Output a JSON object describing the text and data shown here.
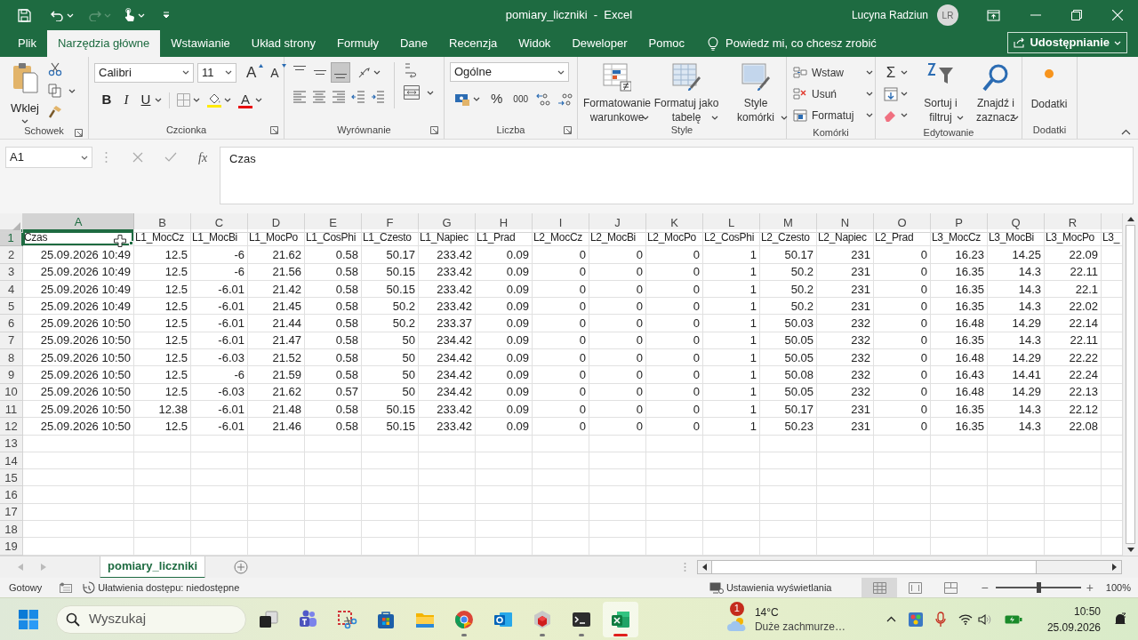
{
  "title_bar": {
    "document_title": "pomiary_liczniki  -  Excel",
    "user_name": "Lucyna Radziun",
    "avatar_initials": "LR"
  },
  "tabs": [
    {
      "label": "Plik",
      "selected": false
    },
    {
      "label": "Narzędzia główne",
      "selected": true
    },
    {
      "label": "Wstawianie",
      "selected": false
    },
    {
      "label": "Układ strony",
      "selected": false
    },
    {
      "label": "Formuły",
      "selected": false
    },
    {
      "label": "Dane",
      "selected": false
    },
    {
      "label": "Recenzja",
      "selected": false
    },
    {
      "label": "Widok",
      "selected": false
    },
    {
      "label": "Deweloper",
      "selected": false
    },
    {
      "label": "Pomoc",
      "selected": false
    }
  ],
  "tell_me": "Powiedz mi, co chcesz zrobić",
  "share_button": "Udostępnianie",
  "ribbon": {
    "clipboard": {
      "label": "Schowek",
      "paste": "Wklej"
    },
    "font": {
      "label": "Czcionka",
      "font_name": "Calibri",
      "font_size": "11",
      "grow": "A",
      "shrink": "A",
      "bold": "B",
      "italic": "I",
      "underline": "U",
      "font_color": "A"
    },
    "alignment": {
      "label": "Wyrównanie",
      "vertical_align": [
        {
          "kind": "top",
          "selected": false
        },
        {
          "kind": "middle",
          "selected": false
        },
        {
          "kind": "bottom",
          "selected": true
        }
      ]
    },
    "number": {
      "label": "Liczba",
      "format": "Ogólne",
      "percent": "%",
      "thousands": "000"
    },
    "styles": {
      "label": "Style",
      "buttons": [
        {
          "kind": "conditional",
          "label": "Formatowanie\nwarunkowe"
        },
        {
          "kind": "table",
          "label": "Formatuj jako\ntabelę"
        },
        {
          "kind": "cell_styles",
          "label": "Style\nkomórki"
        }
      ]
    },
    "cells": {
      "label": "Komórki",
      "buttons": [
        {
          "kind": "insert",
          "label": "Wstaw"
        },
        {
          "kind": "delete",
          "label": "Usuń"
        },
        {
          "kind": "format",
          "label": "Formatuj"
        }
      ]
    },
    "editing": {
      "label": "Edytowanie",
      "sum": "Σ",
      "buttons": [
        {
          "kind": "sort",
          "label": "Sortuj i\nfiltruj"
        },
        {
          "kind": "find",
          "label": "Znajdź i\nzaznacz"
        }
      ]
    },
    "addins": {
      "label": "Dodatki",
      "button": "Dodatki"
    }
  },
  "formula_bar": {
    "name_box": "A1",
    "function_label": "fx",
    "content": "Czas"
  },
  "sheet": {
    "columns": [
      {
        "label": "A",
        "selected": true
      },
      {
        "label": "B",
        "selected": false
      },
      {
        "label": "C",
        "selected": false
      },
      {
        "label": "D",
        "selected": false
      },
      {
        "label": "E",
        "selected": false
      },
      {
        "label": "F",
        "selected": false
      },
      {
        "label": "G",
        "selected": false
      },
      {
        "label": "H",
        "selected": false
      },
      {
        "label": "I",
        "selected": false
      },
      {
        "label": "J",
        "selected": false
      },
      {
        "label": "K",
        "selected": false
      },
      {
        "label": "L",
        "selected": false
      },
      {
        "label": "M",
        "selected": false
      },
      {
        "label": "N",
        "selected": false
      },
      {
        "label": "O",
        "selected": false
      },
      {
        "label": "P",
        "selected": false
      },
      {
        "label": "Q",
        "selected": false
      },
      {
        "label": "R",
        "selected": false
      }
    ],
    "rows": [
      {
        "number": "1",
        "selected": true,
        "kind": "text",
        "cells": [
          "Czas",
          "L1_MocCz",
          "L1_MocBi",
          "L1_MocPo",
          "L1_CosPhi",
          "L1_Czesto",
          "L1_Napiec",
          "L1_Prad",
          "L2_MocCz",
          "L2_MocBi",
          "L2_MocPo",
          "L2_CosPhi",
          "L2_Czesto",
          "L2_Napiec",
          "L2_Prad",
          "L3_MocCz",
          "L3_MocBi",
          "L3_MocPo",
          "L3_"
        ]
      },
      {
        "number": "2",
        "selected": false,
        "kind": "number",
        "cells": [
          "25.09.2026 10:49",
          "12.5",
          "-6",
          "21.62",
          "0.58",
          "50.17",
          "233.42",
          "0.09",
          "0",
          "0",
          "0",
          "1",
          "50.17",
          "231",
          "0",
          "16.23",
          "14.25",
          "22.09"
        ]
      },
      {
        "number": "3",
        "selected": false,
        "kind": "number",
        "cells": [
          "25.09.2026 10:49",
          "12.5",
          "-6",
          "21.56",
          "0.58",
          "50.15",
          "233.42",
          "0.09",
          "0",
          "0",
          "0",
          "1",
          "50.2",
          "231",
          "0",
          "16.35",
          "14.3",
          "22.11"
        ]
      },
      {
        "number": "4",
        "selected": false,
        "kind": "number",
        "cells": [
          "25.09.2026 10:49",
          "12.5",
          "-6.01",
          "21.42",
          "0.58",
          "50.15",
          "233.42",
          "0.09",
          "0",
          "0",
          "0",
          "1",
          "50.2",
          "231",
          "0",
          "16.35",
          "14.3",
          "22.1"
        ]
      },
      {
        "number": "5",
        "selected": false,
        "kind": "number",
        "cells": [
          "25.09.2026 10:49",
          "12.5",
          "-6.01",
          "21.45",
          "0.58",
          "50.2",
          "233.42",
          "0.09",
          "0",
          "0",
          "0",
          "1",
          "50.2",
          "231",
          "0",
          "16.35",
          "14.3",
          "22.02"
        ]
      },
      {
        "number": "6",
        "selected": false,
        "kind": "number",
        "cells": [
          "25.09.2026 10:50",
          "12.5",
          "-6.01",
          "21.44",
          "0.58",
          "50.2",
          "233.37",
          "0.09",
          "0",
          "0",
          "0",
          "1",
          "50.03",
          "232",
          "0",
          "16.48",
          "14.29",
          "22.14"
        ]
      },
      {
        "number": "7",
        "selected": false,
        "kind": "number",
        "cells": [
          "25.09.2026 10:50",
          "12.5",
          "-6.01",
          "21.47",
          "0.58",
          "50",
          "234.42",
          "0.09",
          "0",
          "0",
          "0",
          "1",
          "50.05",
          "232",
          "0",
          "16.35",
          "14.3",
          "22.11"
        ]
      },
      {
        "number": "8",
        "selected": false,
        "kind": "number",
        "cells": [
          "25.09.2026 10:50",
          "12.5",
          "-6.03",
          "21.52",
          "0.58",
          "50",
          "234.42",
          "0.09",
          "0",
          "0",
          "0",
          "1",
          "50.05",
          "232",
          "0",
          "16.48",
          "14.29",
          "22.22"
        ]
      },
      {
        "number": "9",
        "selected": false,
        "kind": "number",
        "cells": [
          "25.09.2026 10:50",
          "12.5",
          "-6",
          "21.59",
          "0.58",
          "50",
          "234.42",
          "0.09",
          "0",
          "0",
          "0",
          "1",
          "50.08",
          "232",
          "0",
          "16.43",
          "14.41",
          "22.24"
        ]
      },
      {
        "number": "10",
        "selected": false,
        "kind": "number",
        "cells": [
          "25.09.2026 10:50",
          "12.5",
          "-6.03",
          "21.62",
          "0.57",
          "50",
          "234.42",
          "0.09",
          "0",
          "0",
          "0",
          "1",
          "50.05",
          "232",
          "0",
          "16.48",
          "14.29",
          "22.13"
        ]
      },
      {
        "number": "11",
        "selected": false,
        "kind": "number",
        "cells": [
          "25.09.2026 10:50",
          "12.38",
          "-6.01",
          "21.48",
          "0.58",
          "50.15",
          "233.42",
          "0.09",
          "0",
          "0",
          "0",
          "1",
          "50.17",
          "231",
          "0",
          "16.35",
          "14.3",
          "22.12"
        ]
      },
      {
        "number": "12",
        "selected": false,
        "kind": "number",
        "cells": [
          "25.09.2026 10:50",
          "12.5",
          "-6.01",
          "21.46",
          "0.58",
          "50.15",
          "233.42",
          "0.09",
          "0",
          "0",
          "0",
          "1",
          "50.23",
          "231",
          "0",
          "16.35",
          "14.3",
          "22.08"
        ]
      },
      {
        "number": "13",
        "selected": false,
        "kind": "number",
        "cells": []
      },
      {
        "number": "14",
        "selected": false,
        "kind": "number",
        "cells": []
      },
      {
        "number": "15",
        "selected": false,
        "kind": "number",
        "cells": []
      },
      {
        "number": "16",
        "selected": false,
        "kind": "number",
        "cells": []
      },
      {
        "number": "17",
        "selected": false,
        "kind": "number",
        "cells": []
      },
      {
        "number": "18",
        "selected": false,
        "kind": "number",
        "cells": []
      },
      {
        "number": "19",
        "selected": false,
        "kind": "number",
        "cells": []
      }
    ]
  },
  "sheet_tabs": [
    {
      "label": "pomiary_liczniki",
      "selected": true
    }
  ],
  "status_bar": {
    "ready": "Gotowy",
    "accessibility": "Ułatwienia dostępu: niedostępne",
    "display_settings": "Ustawienia wyświetlania",
    "views": [
      {
        "kind": "normal",
        "selected": true
      },
      {
        "kind": "page_layout",
        "selected": false
      },
      {
        "kind": "page_break",
        "selected": false
      }
    ],
    "zoom_out": "−",
    "zoom_in": "+",
    "zoom": {
      "level": 0.5
    },
    "zoom_reading": "100%"
  },
  "taskbar": {
    "search_placeholder": "Wyszukaj",
    "apps": [
      {
        "kind": "task_view",
        "running": false,
        "selected": false
      },
      {
        "kind": "teams",
        "running": false,
        "selected": false
      },
      {
        "kind": "snipping",
        "running": false,
        "selected": false
      },
      {
        "kind": "store",
        "running": false,
        "selected": false
      },
      {
        "kind": "folder",
        "running": false,
        "selected": false
      },
      {
        "kind": "chrome",
        "running": true,
        "selected": false
      },
      {
        "kind": "outlook",
        "running": false,
        "selected": false
      },
      {
        "kind": "cube",
        "running": true,
        "selected": false
      },
      {
        "kind": "terminal",
        "running": true,
        "selected": false
      },
      {
        "kind": "excel",
        "running": true,
        "selected": true
      }
    ],
    "weather": {
      "badge": "1",
      "temperature": "14°C",
      "description": "Duże zachmurze…"
    },
    "time": "10:50",
    "date": "25.09.2026"
  }
}
